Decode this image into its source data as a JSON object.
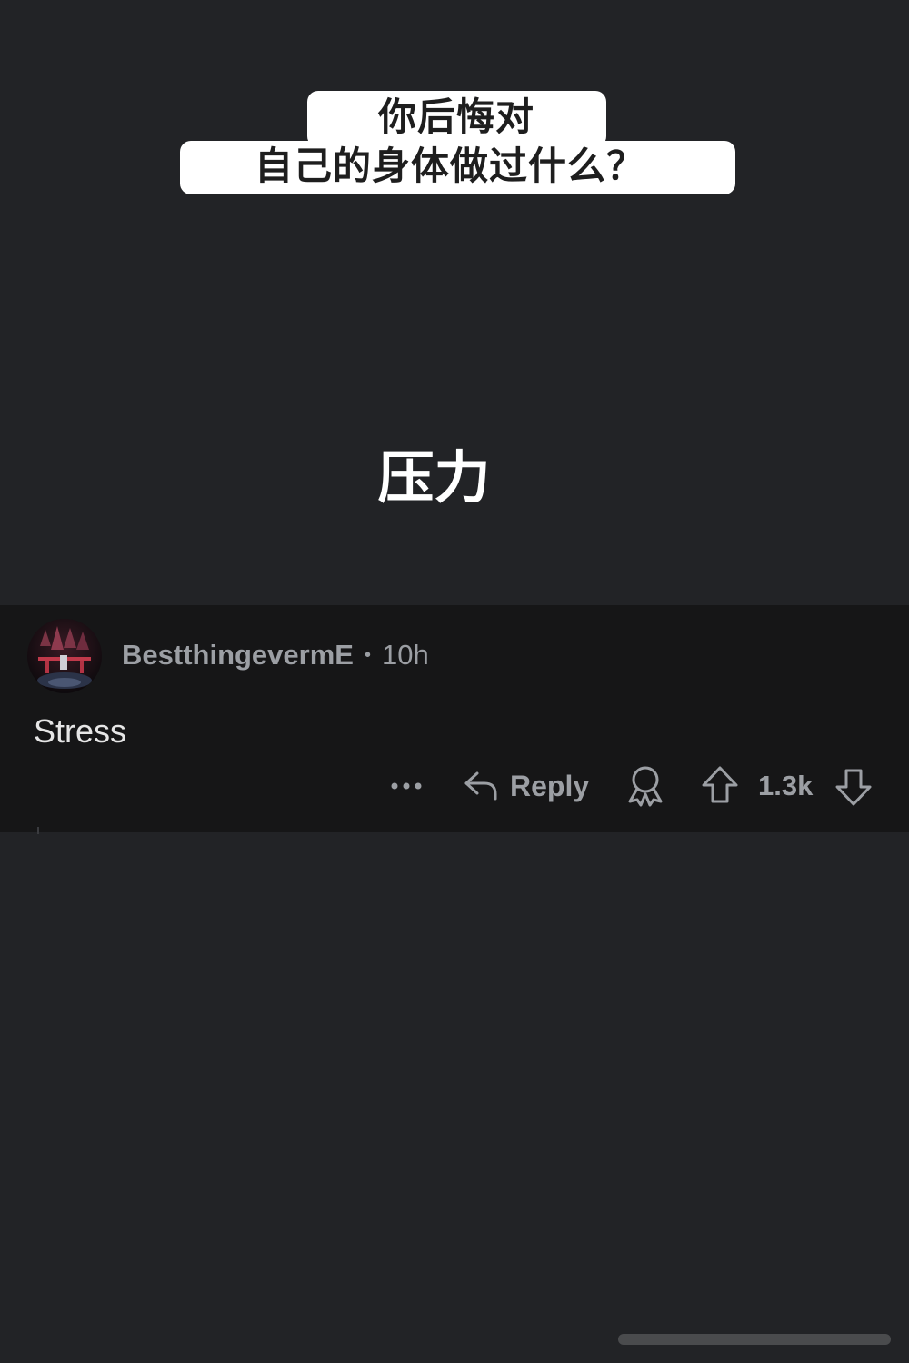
{
  "caption": {
    "line1": "你后悔对",
    "line2": "自己的身体做过什么？"
  },
  "translation": "压力",
  "comment": {
    "username": "BestthingevermE",
    "separator": "•",
    "timestamp": "10h",
    "body": "Stress",
    "actions": {
      "more_icon": "more-horizontal-icon",
      "reply_icon": "reply-arrow-icon",
      "reply_label": "Reply",
      "award_icon": "award-icon",
      "upvote_icon": "upvote-arrow-icon",
      "vote_count": "1.3k",
      "downvote_icon": "downvote-arrow-icon"
    }
  },
  "colors": {
    "background": "#222326",
    "card": "#161617",
    "caption_box": "#ffffff",
    "meta_text": "#9b9ea3",
    "body_text": "#e6e6e6"
  }
}
